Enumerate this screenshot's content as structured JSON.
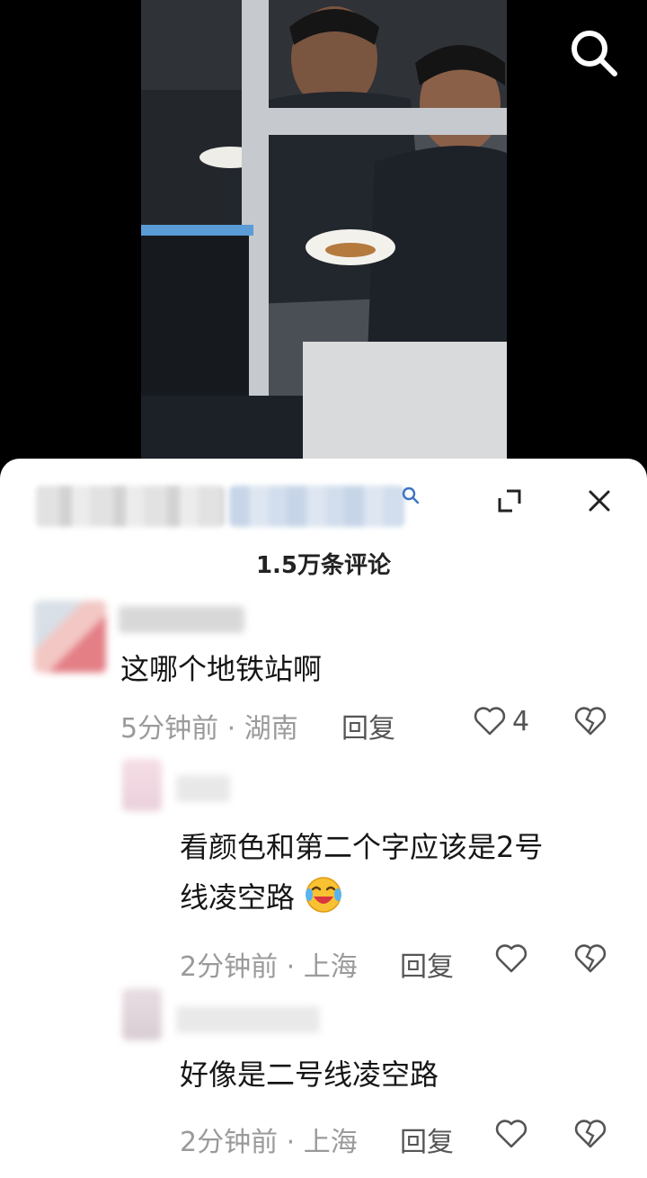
{
  "video": {
    "description_hidden": ""
  },
  "sheet": {
    "comment_count": "1.5万条评论"
  },
  "comments": [
    {
      "text": "这哪个地铁站啊",
      "time": "5分钟前",
      "location": "湖南",
      "reply": "回复",
      "likes": "4"
    },
    {
      "text_line1": "看颜色和第二个字应该是2号",
      "text_line2": "线凌空路",
      "emoji": "laughing-crying-emoji",
      "time": "2分钟前",
      "location": "上海",
      "reply": "回复"
    },
    {
      "text": "好像是二号线凌空路",
      "time": "2分钟前",
      "location": "上海",
      "reply": "回复"
    }
  ],
  "meta_separator": " · "
}
